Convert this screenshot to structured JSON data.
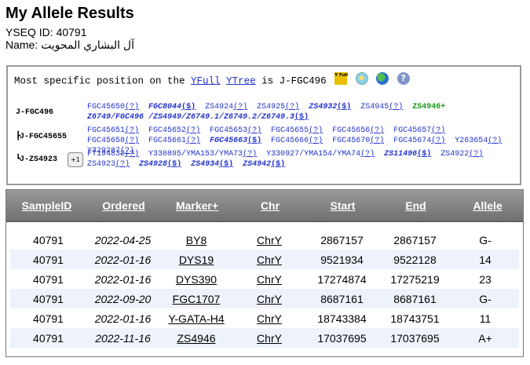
{
  "page": {
    "title": "My Allele Results",
    "yseq_id_text": "YSEQ ID: 40791",
    "name_text": "Name: آل البشاري المحويت"
  },
  "position": {
    "prefix": "Most specific position on the ",
    "yfull_link": "YFull",
    "ytree_link": "YTree",
    "suffix": " is J-FGC496",
    "icons": [
      "yfull-logo-icon",
      "map-icon",
      "globe-icon",
      "help-icon"
    ],
    "yfull_icon_text": "Y Full",
    "help_icon_text": "?"
  },
  "branches": [
    {
      "label": "J-FGC496",
      "glyph": "",
      "snps": [
        {
          "name": "FGC45650",
          "q": "(?)",
          "style": "normal"
        },
        {
          "name": "FGC8044",
          "q": "($)",
          "style": "bold"
        },
        {
          "name": "ZS4924",
          "q": "(?)",
          "style": "normal"
        },
        {
          "name": "ZS4925",
          "q": "(?)",
          "style": "normal"
        },
        {
          "name": "ZS4932",
          "q": "($)",
          "style": "bold"
        },
        {
          "name": "ZS4945",
          "q": "(?)",
          "style": "normal"
        },
        {
          "name": "ZS4946+",
          "q": "",
          "style": "derived"
        },
        {
          "name": "Z6749/FGC496 /ZS4949/Z6749.1/Z6749.2/Z6749.3",
          "q": "($)",
          "style": "bold"
        }
      ]
    },
    {
      "label": "J-FGC45655",
      "glyph": "┣",
      "snps": [
        {
          "name": "FGC45651",
          "q": "(?)",
          "style": "normal"
        },
        {
          "name": "FGC45652",
          "q": "(?)",
          "style": "normal"
        },
        {
          "name": "FGC45653",
          "q": "(?)",
          "style": "normal"
        },
        {
          "name": "FGC45655",
          "q": "(?)",
          "style": "normal"
        },
        {
          "name": "FGC45656",
          "q": "(?)",
          "style": "normal"
        },
        {
          "name": "FGC45657",
          "q": "(?)",
          "style": "normal"
        },
        {
          "name": "FGC45658",
          "q": "(?)",
          "style": "normal"
        },
        {
          "name": "FGC45661",
          "q": "(?)",
          "style": "normal"
        },
        {
          "name": "FGC45663",
          "q": "($)",
          "style": "bold"
        },
        {
          "name": "FGC45666",
          "q": "(?)",
          "style": "normal"
        },
        {
          "name": "FGC45670",
          "q": "(?)",
          "style": "normal"
        },
        {
          "name": "FGC45674",
          "q": "(?)",
          "style": "normal"
        },
        {
          "name": "Y263654",
          "q": "(?)",
          "style": "normal"
        },
        {
          "name": "Y329287",
          "q": "(?)",
          "style": "normal"
        }
      ]
    },
    {
      "label": "J-ZS4923",
      "glyph": "┗",
      "plus_label": "+1",
      "snps": [
        {
          "name": "FT194832",
          "q": "(?)",
          "style": "normal"
        },
        {
          "name": "Y330895/YMA153/YMA73",
          "q": "(?)",
          "style": "normal"
        },
        {
          "name": "Y330927/YMA154/YMA74",
          "q": "(?)",
          "style": "normal"
        },
        {
          "name": "ZS11496",
          "q": "($)",
          "style": "bold"
        },
        {
          "name": "ZS4922",
          "q": "(?)",
          "style": "normal"
        },
        {
          "name": "ZS4923",
          "q": "(?)",
          "style": "normal"
        },
        {
          "name": "ZS4928",
          "q": "($)",
          "style": "bold"
        },
        {
          "name": "ZS4934",
          "q": "($)",
          "style": "bold"
        },
        {
          "name": "ZS4942",
          "q": "($)",
          "style": "bold"
        }
      ]
    }
  ],
  "table": {
    "headers": [
      "SampleID",
      "Ordered",
      "Marker+",
      "Chr",
      "Start",
      "End",
      "Allele"
    ],
    "rows": [
      [
        "40791",
        "2022-04-25",
        "BY8",
        "ChrY",
        "2867157",
        "2867157",
        "G-"
      ],
      [
        "40791",
        "2022-01-16",
        "DYS19",
        "ChrY",
        "9521934",
        "9522128",
        "14"
      ],
      [
        "40791",
        "2022-01-16",
        "DYS390",
        "ChrY",
        "17274874",
        "17275219",
        "23"
      ],
      [
        "40791",
        "2022-09-20",
        "FGC1707",
        "ChrY",
        "8687161",
        "8687161",
        "G-"
      ],
      [
        "40791",
        "2022-01-16",
        "Y-GATA-H4",
        "ChrY",
        "18743384",
        "18743751",
        "11"
      ],
      [
        "40791",
        "2022-11-16",
        "ZS4946",
        "ChrY",
        "17037695",
        "17037695",
        "A+"
      ]
    ]
  },
  "colors": {
    "link": "#2233cc",
    "derived": "#119911",
    "header_bg": "#7f7f7f",
    "row_alt": "#eef3fb"
  }
}
